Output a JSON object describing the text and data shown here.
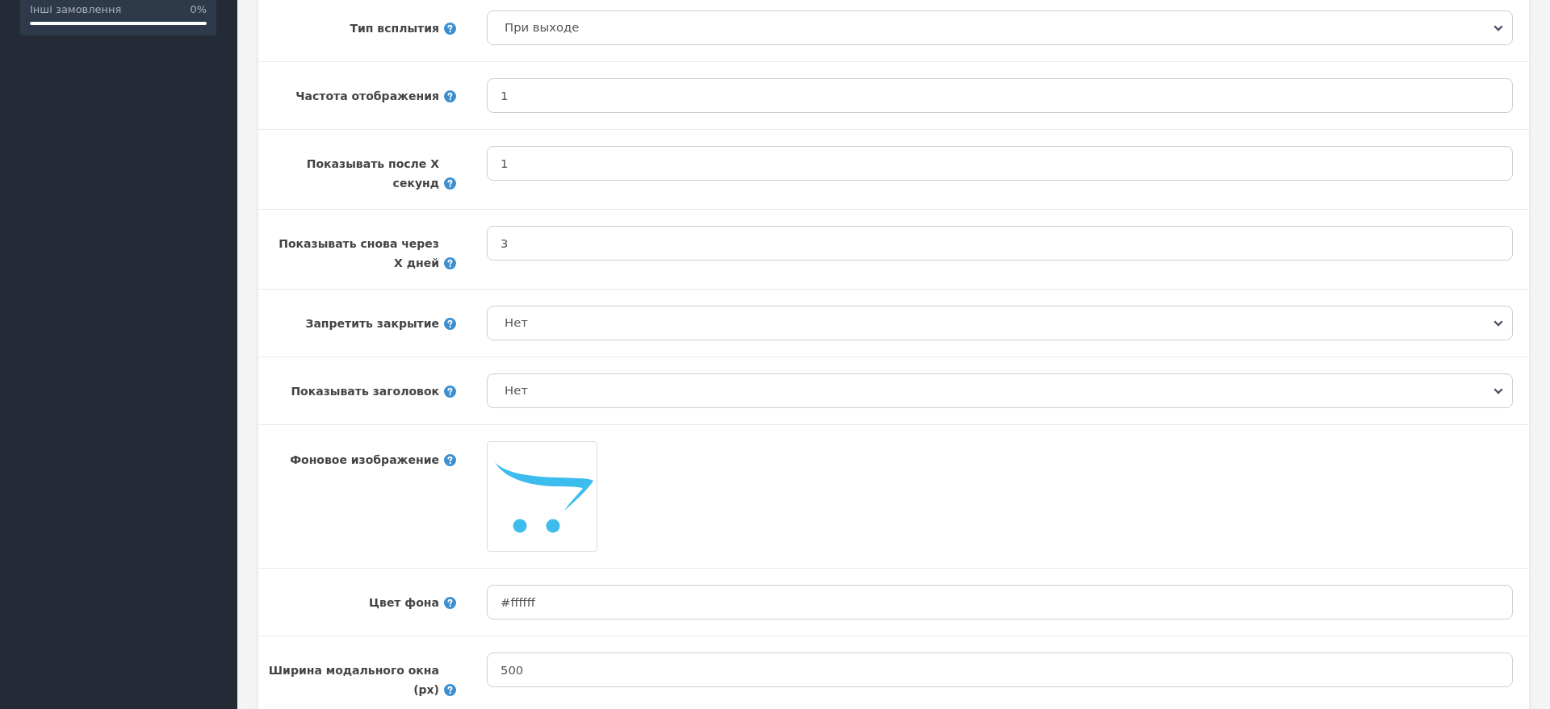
{
  "sidebar": {
    "stats": [
      {
        "label": "Інші замовлення",
        "reading": "0%",
        "level": 0
      }
    ]
  },
  "form": {
    "rows": [
      {
        "label": "Тип всплытия",
        "kind": "select",
        "value": "При выходе"
      },
      {
        "label": "Частота отображения",
        "kind": "input",
        "value": "1"
      },
      {
        "label": "Показывать после X секунд",
        "kind": "input",
        "value": "1"
      },
      {
        "label": "Показывать снова через X дней",
        "kind": "input",
        "value": "3"
      },
      {
        "label": "Запретить закрытие",
        "kind": "select",
        "value": "Нет"
      },
      {
        "label": "Показывать заголовок",
        "kind": "select",
        "value": "Нет"
      },
      {
        "label": "Фоновое изображение",
        "kind": "image"
      },
      {
        "label": "Цвет фона",
        "kind": "input",
        "value": "#ffffff"
      },
      {
        "label": "Ширина модального окна (px)",
        "kind": "input",
        "value": "500"
      }
    ]
  }
}
